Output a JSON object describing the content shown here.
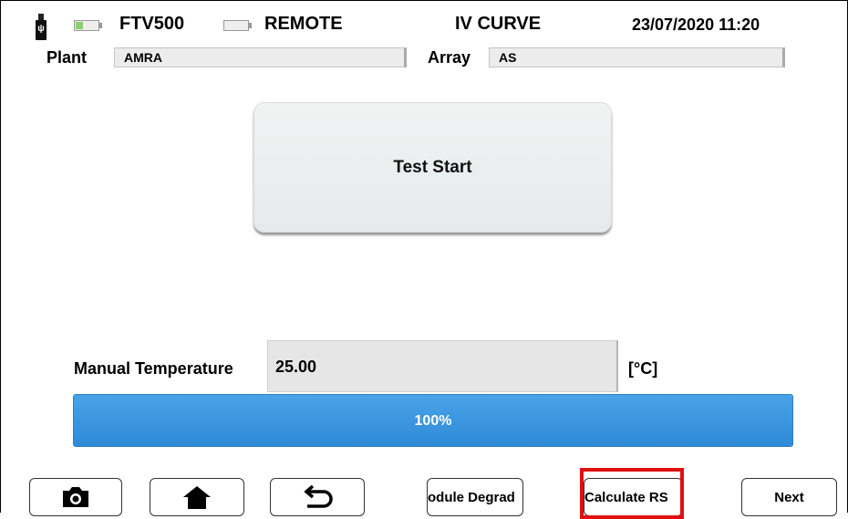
{
  "status_bar": {
    "device": "FTV500",
    "remote": "REMOTE",
    "mode": "IV CURVE",
    "datetime": "23/07/2020 11:20",
    "battery_device_level": 0.3,
    "battery_remote_level": 0.0,
    "battery_color": "#8bcf6a"
  },
  "fields": {
    "plant_label": "Plant",
    "plant_value": "AMRA",
    "array_label": "Array",
    "array_value": "AS"
  },
  "test_start_label": "Test Start",
  "temperature": {
    "label": "Manual Temperature",
    "value": "25.00",
    "unit": "[°C]"
  },
  "progress": {
    "label": "100%",
    "percent": 100,
    "color": "#2f8ad6"
  },
  "toolbar": {
    "camera_icon": "camera-icon",
    "home_icon": "home-icon",
    "back_icon": "back-arrow-icon",
    "module_degradation_label": "odule Degrad",
    "calculate_rs_label": "Calculate RS",
    "next_label": "Next",
    "highlight_color": "#e01010"
  }
}
